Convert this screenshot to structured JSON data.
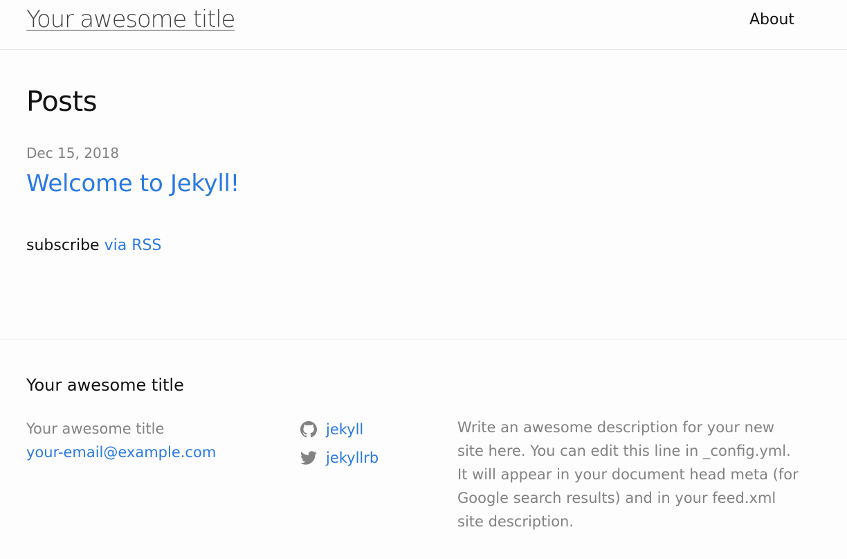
{
  "header": {
    "site_title": "Your awesome title",
    "nav": {
      "about_label": "About"
    }
  },
  "main": {
    "heading": "Posts",
    "posts": [
      {
        "date": "Dec 15, 2018",
        "title": "Welcome to Jekyll!"
      }
    ],
    "subscribe": {
      "prefix": "subscribe",
      "link_label": "via RSS"
    }
  },
  "footer": {
    "heading": "Your awesome title",
    "name": "Your awesome title",
    "email": "your-email@example.com",
    "social": [
      {
        "icon": "github-icon",
        "label": "jekyll"
      },
      {
        "icon": "twitter-icon",
        "label": "jekyllrb"
      }
    ],
    "description": "Write an awesome description for your new site here. You can edit this line in _config.yml. It will appear in your document head meta (for Google search results) and in your feed.xml site description."
  },
  "colors": {
    "link": "#2a7ae2",
    "meta_grey": "#828282",
    "text": "#111111",
    "border": "#e8e8e8",
    "background": "#fdfdfd"
  }
}
